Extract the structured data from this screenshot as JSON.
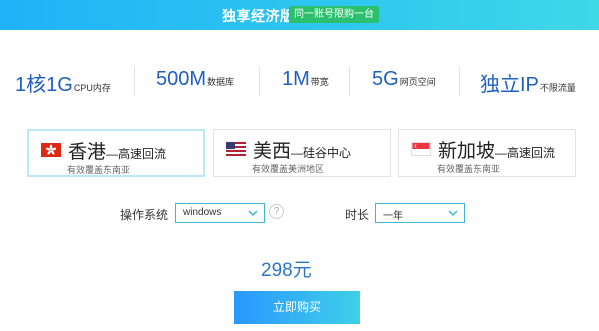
{
  "banner": {
    "title": "独享经济版",
    "tag": "同一账号限购一台"
  },
  "specs": [
    {
      "value": "1核1G",
      "label": "CPU内存"
    },
    {
      "value": "500M",
      "label": "数据库"
    },
    {
      "value": "1M",
      "label": "带宽"
    },
    {
      "value": "5G",
      "label": "网页空间"
    },
    {
      "value": "独立IP",
      "label": "不限流量"
    }
  ],
  "regions": [
    {
      "name": "香港",
      "sub": "—高速回流",
      "desc": "有效覆盖东南亚",
      "flag_icon": "hong-kong-flag-icon",
      "selected": true
    },
    {
      "name": "美西",
      "sub": "—硅谷中心",
      "desc": "有效覆盖美洲地区",
      "flag_icon": "usa-flag-icon",
      "selected": false
    },
    {
      "name": "新加坡",
      "sub": "—高速回流",
      "desc": "有效覆盖东南亚",
      "flag_icon": "singapore-flag-icon",
      "selected": false
    }
  ],
  "os": {
    "label": "操作系统",
    "value": "windows",
    "help": "?"
  },
  "duration": {
    "label": "时长",
    "value": "一年"
  },
  "price": "298元",
  "buy_label": "立即购买",
  "colors": {
    "accent": "#2c76c9",
    "banner_tag": "#2bc06d",
    "select_border": "#3db4d8"
  }
}
